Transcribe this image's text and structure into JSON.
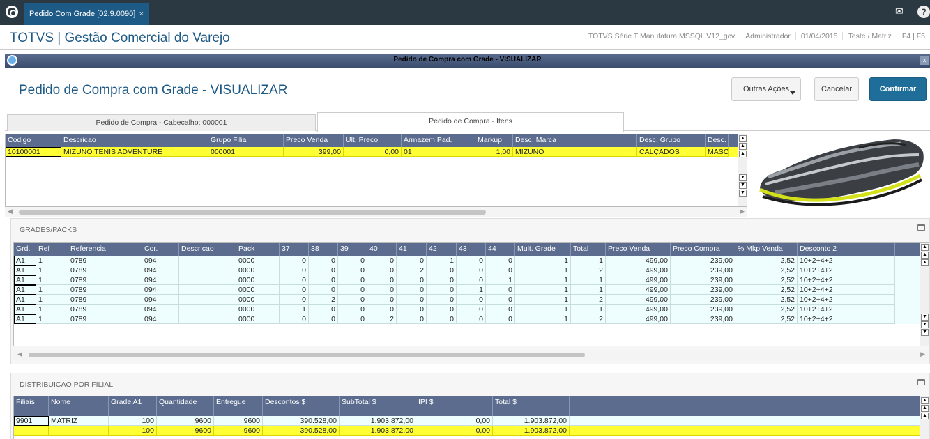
{
  "tab": {
    "title": "Pedido Com Grade [02.9.0090]",
    "close": "×"
  },
  "app": {
    "title": "TOTVS | Gestão Comercial do Varejo",
    "info": [
      "TOTVS Série T Manufatura MSSQL V12_gcv",
      "Administrador",
      "01/04/2015",
      "Teste / Matriz",
      "F4 | F5"
    ]
  },
  "dialog": {
    "bar_title": "Pedido de Compra com Grade - VISUALIZAR",
    "title": "Pedido de Compra com Grade - VISUALIZAR",
    "close": "x"
  },
  "buttons": {
    "outras": "Outras Ações",
    "cancelar": "Cancelar",
    "confirmar": "Confirmar"
  },
  "tabs": [
    "Pedido de Compra - Cabecalho: 000001",
    "Pedido de Compra - Itens"
  ],
  "itens": {
    "headers": [
      "Codigo",
      "Descricao",
      "Grupo Filial",
      "Preco Venda",
      "Ult. Preco",
      "Armazem Pad.",
      "Markup",
      "Desc. Marca",
      "Desc. Grupo",
      "Desc."
    ],
    "rows": [
      [
        "10100001",
        "MIZUNO TENIS ADVENTURE",
        "000001",
        "399,00",
        "0,00",
        "01",
        "1,00",
        "MIZUNO",
        "CALÇADOS",
        "MASC"
      ]
    ]
  },
  "grades": {
    "title": "GRADES/PACKS",
    "headers": [
      "Grd.",
      "Ref",
      "Referencia",
      "Cor.",
      "Descricao",
      "Pack",
      "37",
      "38",
      "39",
      "40",
      "41",
      "42",
      "43",
      "44",
      "Mult. Grade",
      "Total",
      "Preco Venda",
      "Preco Compra",
      "% Mkp Venda",
      "Desconto 2"
    ],
    "rows": [
      [
        "A1",
        "1",
        "0789",
        "094",
        "",
        "0000",
        "0",
        "0",
        "0",
        "0",
        "0",
        "1",
        "0",
        "0",
        "1",
        "1",
        "499,00",
        "239,00",
        "2,52",
        "10+2+4+2"
      ],
      [
        "A1",
        "1",
        "0789",
        "094",
        "",
        "0000",
        "0",
        "0",
        "0",
        "0",
        "2",
        "0",
        "0",
        "0",
        "1",
        "2",
        "499,00",
        "239,00",
        "2,52",
        "10+2+4+2"
      ],
      [
        "A1",
        "1",
        "0789",
        "094",
        "",
        "0000",
        "0",
        "0",
        "0",
        "0",
        "0",
        "0",
        "0",
        "1",
        "1",
        "1",
        "499,00",
        "239,00",
        "2,52",
        "10+2+4+2"
      ],
      [
        "A1",
        "1",
        "0789",
        "094",
        "",
        "0000",
        "0",
        "0",
        "0",
        "0",
        "0",
        "0",
        "1",
        "0",
        "1",
        "1",
        "499,00",
        "239,00",
        "2,52",
        "10+2+4+2"
      ],
      [
        "A1",
        "1",
        "0789",
        "094",
        "",
        "0000",
        "0",
        "2",
        "0",
        "0",
        "0",
        "0",
        "0",
        "0",
        "1",
        "2",
        "499,00",
        "239,00",
        "2,52",
        "10+2+4+2"
      ],
      [
        "A1",
        "1",
        "0789",
        "094",
        "",
        "0000",
        "1",
        "0",
        "0",
        "0",
        "0",
        "0",
        "0",
        "0",
        "1",
        "1",
        "499,00",
        "239,00",
        "2,52",
        "10+2+4+2"
      ],
      [
        "A1",
        "1",
        "0789",
        "094",
        "",
        "0000",
        "0",
        "0",
        "0",
        "2",
        "0",
        "0",
        "0",
        "0",
        "1",
        "2",
        "499,00",
        "239,00",
        "2,52",
        "10+2+4+2"
      ]
    ]
  },
  "distrib": {
    "title": "DISTRIBUICAO POR FILIAL",
    "headers": [
      "Filiais",
      "Nome",
      "Grade A1",
      "Quantidade",
      "Entregue",
      "Descontos $",
      "SubTotal $",
      "IPI $",
      "Total $"
    ],
    "rows": [
      [
        "9901",
        "MATRIZ",
        "100",
        "9600",
        "9600",
        "390.528,00",
        "1.903.872,00",
        "0,00",
        "1.903.872,00"
      ]
    ],
    "totals": [
      "",
      "",
      "100",
      "9600",
      "9600",
      "390.528,00",
      "1.903.872,00",
      "0,00",
      "1.903.872,00"
    ]
  },
  "icons": {
    "logo": "totvs-logo-icon",
    "mail": "mail-icon",
    "help": "help-icon",
    "product": "sneaker-image"
  }
}
